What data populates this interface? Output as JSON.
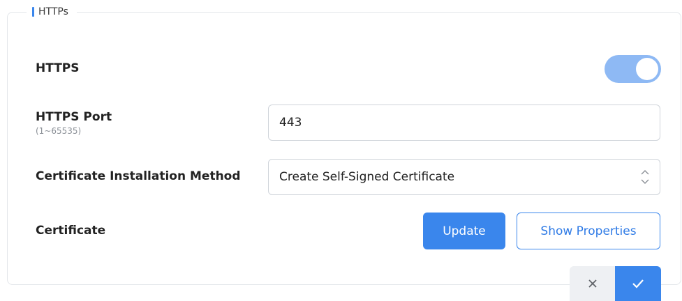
{
  "section": {
    "legend": "HTTPs",
    "accent_color": "#3a86ec"
  },
  "https": {
    "label": "HTTPS",
    "enabled": true,
    "toggle_color": "#8eb9f4"
  },
  "port": {
    "label": "HTTPS Port",
    "range_hint": "(1~65535)",
    "value": "443"
  },
  "cert_method": {
    "label": "Certificate Installation Method",
    "selected": "Create Self-Signed Certificate",
    "icon": "updown-chevron-icon"
  },
  "certificate": {
    "label": "Certificate",
    "update_label": "Update",
    "show_properties_label": "Show Properties"
  },
  "actions": {
    "cancel_icon": "close-icon",
    "confirm_icon": "check-icon"
  }
}
